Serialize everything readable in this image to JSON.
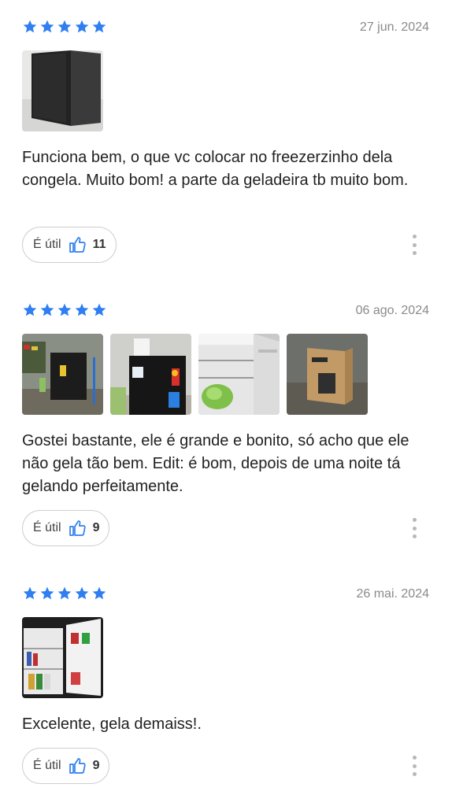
{
  "reviews": [
    {
      "rating": 5,
      "date": "27 jun. 2024",
      "text": "Funciona bem, o que vc colocar no freezerzinho dela congela. Muito bom! a parte da geladeira tb muito bom.",
      "useful_label": "É útil",
      "useful_count": "11",
      "photos": [
        "black-mini-fridge-side-view"
      ]
    },
    {
      "rating": 5,
      "date": "06 ago. 2024",
      "text": "Gostei bastante, ele é grande e bonito, só acho que ele não gela tão bem. Edit: é bom, depois de uma noite tá gelando perfeitamente.",
      "useful_label": "É útil",
      "useful_count": "9",
      "photos": [
        "fridge-in-garage",
        "fridge-front-labels",
        "fridge-interior-lettuce",
        "fridge-box-package"
      ]
    },
    {
      "rating": 5,
      "date": "26 mai. 2024",
      "text": "Excelente, gela demaiss!.",
      "useful_label": "É útil",
      "useful_count": "9",
      "photos": [
        "fridge-open-with-drinks"
      ]
    }
  ],
  "colors": {
    "star": "#2f7ff0",
    "thumb": "#2f7ff0",
    "date": "#8a8a8a",
    "border": "#cfcfcf"
  },
  "icons": {
    "star": "star-icon",
    "thumb": "thumbs-up-icon",
    "more": "more-vertical-icon"
  }
}
